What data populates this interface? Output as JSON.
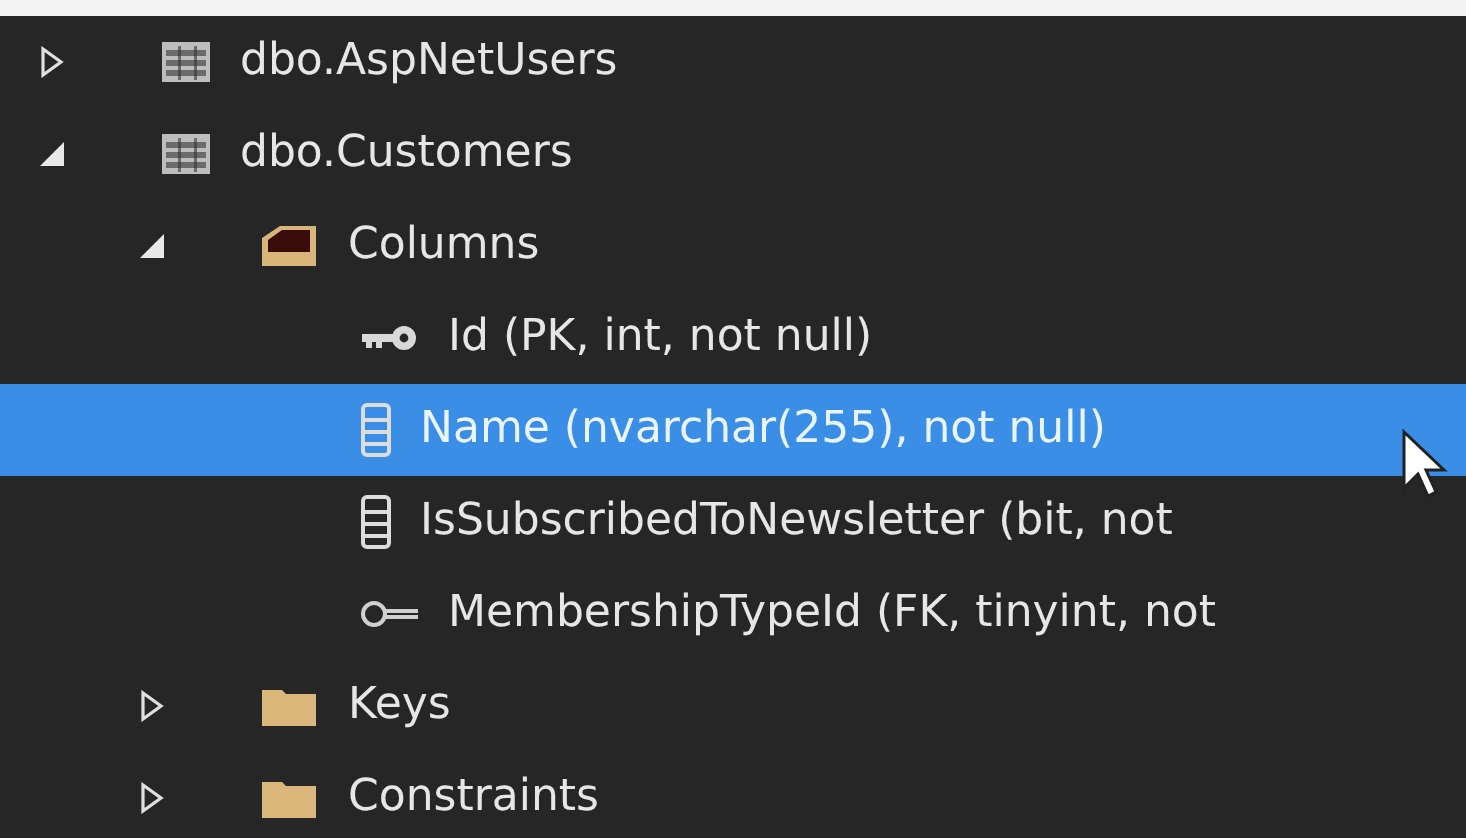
{
  "tree": [
    {
      "label": "dbo.AspNetUsers",
      "kind": "table",
      "expanded": false,
      "selected": false
    },
    {
      "label": "dbo.Customers",
      "kind": "table",
      "expanded": true,
      "selected": false,
      "children": [
        {
          "label": "Columns",
          "kind": "folder",
          "expanded": true,
          "selected": false,
          "children": [
            {
              "label": "Id (PK, int, not null)",
              "kind": "primary-key",
              "selected": false
            },
            {
              "label": "Name (nvarchar(255), not null)",
              "kind": "column",
              "selected": true
            },
            {
              "label": "IsSubscribedToNewsletter (bit, not",
              "kind": "column",
              "selected": false
            },
            {
              "label": "MembershipTypeId (FK, tinyint, not",
              "kind": "foreign-key",
              "selected": false
            }
          ]
        },
        {
          "label": "Keys",
          "kind": "folder",
          "expanded": false,
          "selected": false
        },
        {
          "label": "Constraints",
          "kind": "folder",
          "expanded": false,
          "selected": false
        }
      ]
    }
  ]
}
